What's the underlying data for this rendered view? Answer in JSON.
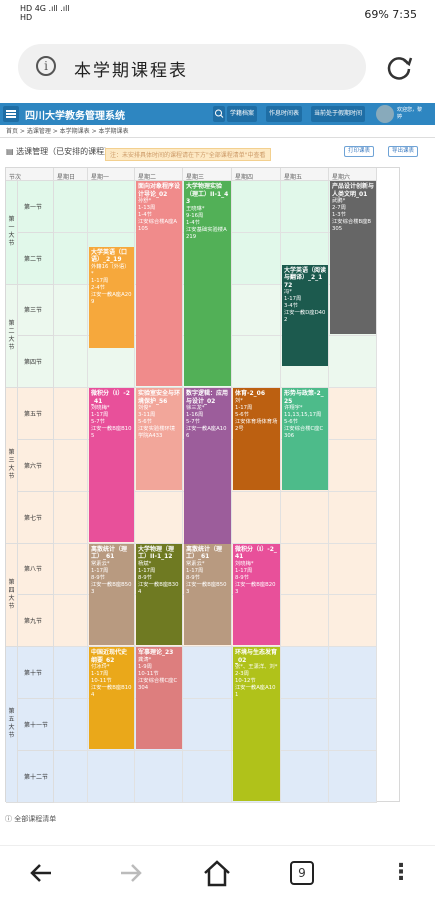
{
  "status": {
    "left_top": "HD 4G .ıll .ıll",
    "left_bottom": "HD",
    "right": "69%  7:35"
  },
  "browser": {
    "url_text": "本学期课程表"
  },
  "header": {
    "title": "四川大学教务管理系统",
    "buttons": [
      "学籍档案",
      "作息时间表",
      "当前处于假期时间"
    ],
    "user": "欢迎您，黎婷"
  },
  "breadcrumb": "首页 > 选课管理 > 本学期课表 > 本学期课表",
  "page": {
    "title": "选课管理（已安排的课程）",
    "notice": "注：未安排具体时间的课程请在下方\"全部课程清单\"中查看",
    "btn_print": "打印课表",
    "btn_export": "导出课表"
  },
  "grid": {
    "header": [
      "节次",
      "星期日",
      "星期一",
      "星期二",
      "星期三",
      "星期四",
      "星期五",
      "星期六"
    ],
    "sections": [
      "第一大节",
      "第二大节",
      "第三大节",
      "第四大节",
      "第五大节"
    ],
    "periods": [
      "第一节",
      "第二节",
      "第三节",
      "第四节",
      "第五节",
      "第六节",
      "第七节",
      "第八节",
      "第九节",
      "第十节",
      "第十一节",
      "第十二节"
    ]
  },
  "courses": [
    {
      "name": "面向对象程序设计导论_02",
      "info": "孙舒*\n1-13周\n1-4节\n江安综合楼A座A105",
      "color": "#f08b8b"
    },
    {
      "name": "大学物理实验（理工）II-1_43",
      "info": "王晓琳*\n9-16周\n1-4节\n江安基础实验楼A219",
      "color": "#52b057"
    },
    {
      "name": "产品设计创新与人类文明_01",
      "info": "武鹏*\n2-7周\n1-3节\n江安综合楼B座B305",
      "color": "#666666"
    },
    {
      "name": "大学英语（口语）_2_19",
      "info": "外籍16（外语）*\n1-17周\n2-4节\n江安一教A座A209",
      "color": "#f6a83c"
    },
    {
      "name": "大学英语（阅读与翻译）_2_172",
      "info": "冯*\n1-17周\n3-4节\n江安一教D座D402",
      "color": "#1c5a4e"
    },
    {
      "name": "微积分（I）-2_41",
      "info": "刘晓梅*\n1-17周\n5-7节\n江安一教B座B105",
      "color": "#e8509a"
    },
    {
      "name": "实验室安全与环境保护_56",
      "info": "刘俊*\n3-11周\n5-6节\n江安实验楼环境学院A433",
      "color": "#f2a69a"
    },
    {
      "name": "数字逻辑：应用与设计_02",
      "info": "徐三龙*\n1-16周\n5-7节\n江安一教A座A106",
      "color": "#9c5d9b"
    },
    {
      "name": "体育-2_06",
      "info": "刘*\n1-17周\n5-6节\n江安体育场体育场2号",
      "color": "#bc6011"
    },
    {
      "name": "形势与政策-2_25",
      "info": "许翔宇*\n11,13,15,17周\n5-6节\n江安综合楼C座C306",
      "color": "#4dbb8a"
    },
    {
      "name": "离散统计（理工）_61",
      "info": "常素云*\n1-17周\n8-9节\n江安一教B座B503",
      "color": "#b89a80"
    },
    {
      "name": "大学物理（理工）II-1_12",
      "info": "杨斌*\n1-17周\n8-9节\n江安一教B座B304",
      "color": "#6f7a22"
    },
    {
      "name": "离散统计（理工）_61",
      "info": "常素云*\n1-17周\n8-9节\n江安一教B座B503",
      "color": "#b89a80"
    },
    {
      "name": "微积分（I）-2_41",
      "info": "刘晓梅*\n1-17周\n8-9节\n江安一教B座B203",
      "color": "#e8509a"
    },
    {
      "name": "中国近现代史纲要_62",
      "info": "付冰玲*\n1-17周\n10-11节\n江安一教B座B104",
      "color": "#eaa81a"
    },
    {
      "name": "军事理论_23",
      "info": "龚涛*\n1-9周\n10-11节\n江安综合楼C座C304",
      "color": "#dd7e7e"
    },
    {
      "name": "环境与生态发育_02",
      "info": "张*、王潇洋、刘*\n2-3周\n10-12节\n江安一教A座A101",
      "color": "#b0c21a"
    }
  ],
  "footer": "全部课程清单",
  "colors": {
    "sec1": "#e1f8ea",
    "sec2": "#ecf8ee",
    "sec3": "#fdeee0",
    "sec4": "#fdeee0",
    "sec5": "#dfeaf8",
    "header_bar": "#2e86c1"
  }
}
